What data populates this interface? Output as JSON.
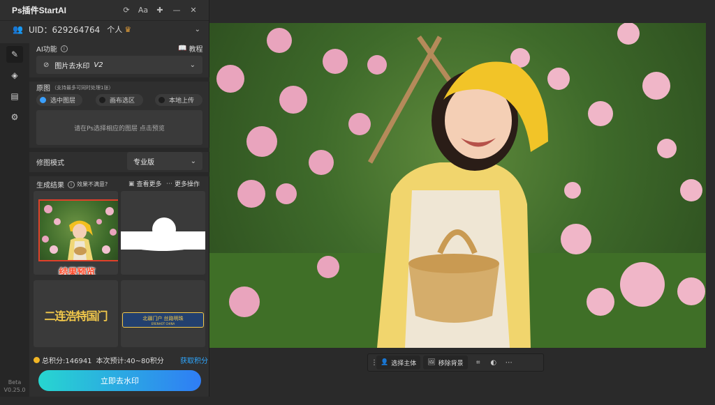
{
  "panel": {
    "title": "Ps插件StartAI",
    "title_icons": [
      "refresh-icon",
      "font-size-icon",
      "pin-icon",
      "minimize-icon",
      "close-icon"
    ],
    "user": {
      "uid": "UID：629264764",
      "plan": "个人"
    }
  },
  "rail": {
    "items": [
      "brush-icon",
      "layers-icon",
      "document-icon",
      "gear-icon"
    ],
    "beta": "Beta",
    "version": "V0.25.0"
  },
  "ai": {
    "label": "AI功能",
    "tutorial": "教程",
    "function_value": "图片去水印",
    "function_version": "V2"
  },
  "source": {
    "label": "原图",
    "hint": "（支持最多可同时处理1张）",
    "options": [
      "选中图层",
      "画布选区",
      "本地上传"
    ],
    "placeholder": "请在Ps选择相应的图层 点击预览"
  },
  "mode": {
    "label": "修图模式",
    "value": "专业版"
  },
  "results": {
    "label": "生成结果",
    "feedback": "效果不满意?",
    "view_more": "查看更多",
    "more_ops": "更多操作",
    "preview_label": "结果预览",
    "banner_left": "二连浩特国门",
    "banner_right_top": "北疆门户 丝路明珠",
    "banner_right_bottom": "ERENHOT CHINA"
  },
  "footer": {
    "points": "总积分:146941",
    "estimate": "本次预计:40~80积分",
    "earn": "获取积分",
    "cta": "立即去水印"
  },
  "toolbar": {
    "select_subject": "选择主体",
    "remove_bg": "移除背景"
  },
  "colors": {
    "accent": "#2ea7ff",
    "preview_border": "#e0402a",
    "preview_text": "#ff4a2a",
    "banner_gold": "#f3c94b",
    "banner_navy": "#23406e"
  }
}
